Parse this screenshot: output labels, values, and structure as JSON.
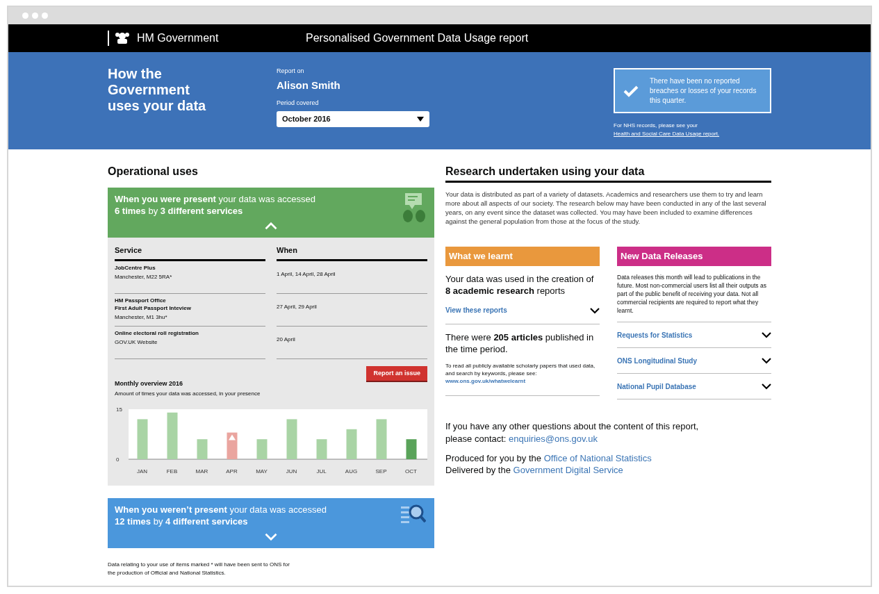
{
  "header": {
    "brand": "HM Government",
    "title": "Personalised Government Data Usage report"
  },
  "banner": {
    "heading": "How the Government uses your data",
    "report_on_label": "Report on",
    "person": "Alison Smith",
    "period_label": "Period covered",
    "period": "October 2016",
    "notice": "There have been no reported breaches or losses of your records this quarter.",
    "nhs_note": "For NHS records, please see your",
    "nhs_link": "Health and Social Care Data Usage report."
  },
  "operational": {
    "heading": "Operational uses",
    "present_panel": {
      "lines": [
        "**When you were present** your data was accessed",
        "**6 times** by **3 different services**"
      ],
      "expanded": true
    },
    "table": {
      "columns": [
        "Service",
        "When"
      ],
      "rows": [
        {
          "service": [
            "JobCentre Plus"
          ],
          "location": "Manchester, M22 5RA*",
          "when": "1 April, 14 April, 28 April"
        },
        {
          "service": [
            "HM Passport Office",
            "First Adult Passport Inteview"
          ],
          "location": "Manchester, M1 3hu*",
          "when": "27 April, 29 April"
        },
        {
          "service": [
            "Online electoral roll registration"
          ],
          "location": "GOV.UK Website",
          "when": "20 April"
        }
      ]
    },
    "report_button": "Report an issue",
    "chart_title": "Monthly overview 2016",
    "chart_subtitle": "Amount of times your data was accessed, in your presence",
    "chart_data": {
      "type": "bar",
      "categories": [
        "JAN",
        "FEB",
        "MAR",
        "APR",
        "MAY",
        "JUN",
        "JUL",
        "AUG",
        "SEP",
        "OCT"
      ],
      "ylim": [
        0,
        15
      ],
      "yticks": [
        0,
        15
      ],
      "series": [
        {
          "color": "#a9d4a5",
          "values": [
            12,
            14,
            6,
            null,
            6,
            12,
            6,
            9,
            12,
            null
          ]
        },
        {
          "color": "#eaa59f",
          "values": [
            null,
            null,
            null,
            8,
            null,
            null,
            null,
            null,
            null,
            null
          ]
        },
        {
          "color": "#5aa35a",
          "values": [
            null,
            null,
            null,
            null,
            null,
            null,
            null,
            null,
            null,
            6
          ]
        }
      ]
    },
    "absent_panel": {
      "lines": [
        "**When you weren’t present** your data was accessed",
        "**12 times** by **4 different services**"
      ],
      "expanded": false
    },
    "footnote": "Data relating to your use of items marked * will have been sent to ONS for the production of Official and National Statistics."
  },
  "research": {
    "heading": "Research undertaken using your data",
    "intro": "Your data is distributed as part of a variety of datasets. Academics and researchers use them to try and learn more about all aspects of our society. The research below may have been conducted in any of the last several years, on any event since the dataset was collected. You may have been included to examine differences against the general population from those at the focus of the study.",
    "learnt": {
      "heading": "What we learnt",
      "used": "Your data was used in the creation of **8 academic research** reports",
      "toggle": {
        "label": "View these reports",
        "expanded": false
      },
      "articles": "There were **205 articles** published in the time period.",
      "read_note": "To read all publicly available scholarly papers that used data, and search by keywords, please see:",
      "read_link": "www.ons.gov.uk/whatwelearnt"
    },
    "releases": {
      "heading": "New Data Releases",
      "intro": "Data releases this month will lead to publications in the future. Most non-commercial users list all their outputs as part of the public benefit of receiving your data. Not all commercial recipients are required to report what they learnt.",
      "items": [
        {
          "label": "Requests for Statistics",
          "expanded": false
        },
        {
          "label": "ONS Longitudinal Study",
          "expanded": false
        },
        {
          "label": "National Pupil Database",
          "expanded": false
        }
      ]
    },
    "contact": {
      "text": "If you have any other questions about the content of this report, please contact:",
      "link": "enquiries@ons.gov.uk"
    },
    "credits": [
      {
        "text": "Produced for you by the",
        "link": "Office of National Statistics"
      },
      {
        "text": "Delivered by the",
        "link": "Government Digital Service"
      }
    ]
  }
}
